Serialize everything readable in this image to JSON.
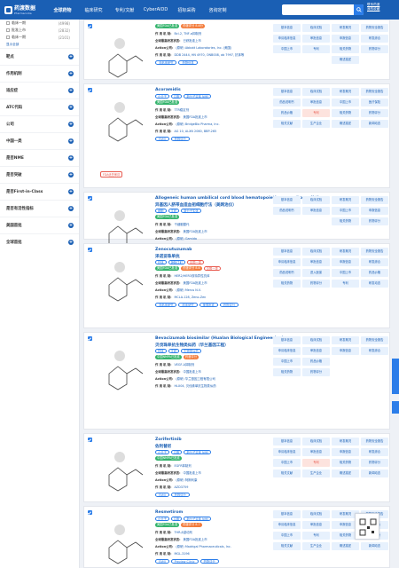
{
  "header": {
    "logo_text": "药渡数据",
    "logo_sub": "Pharmacodia",
    "nav": [
      "全球药物",
      "临床研究",
      "专利/文献",
      "CyberAIDD",
      "招标采购",
      "咨询定制"
    ],
    "search_placeholder": "",
    "links": [
      "联系药渡",
      "我的收藏"
    ]
  },
  "sidebar": {
    "options": [
      {
        "label": "临床一期",
        "count": "(4998)"
      },
      {
        "label": "批准上市",
        "count": "(2832)"
      },
      {
        "label": "临床一期",
        "count": "(2101)"
      }
    ],
    "more_link": "显示全部",
    "facets": [
      "靶点",
      "作用机制",
      "适应症",
      "ATC代码",
      "公司",
      "中国一类",
      "是否NME",
      "是否突破",
      "是否First-in-Class",
      "是否有活性指标",
      "美国首批",
      "全球首批"
    ]
  },
  "colors": {
    "header": "#1a5fb4",
    "accent": "#2b7de9",
    "tag_green": "#33b36b",
    "tag_orange": "#f37b3a",
    "highlight": "#e85a4f"
  },
  "cards": [
    {
      "title": "",
      "title2": "",
      "tags": [
        {
          "t": "美国FDA已批准",
          "c": "green"
        },
        {
          "t": "药渡评分 8.6分",
          "c": "orange"
        }
      ],
      "fields": [
        {
          "k": "作 用 机 制:",
          "v": "Bcl-2, TNF-α抑制剂"
        },
        {
          "k": "全球最高研发状态:",
          "v": "已获批准上市"
        },
        {
          "k": "Action公司:",
          "v": "(原研) Abbott Laboratories, Inc. (美国)"
        },
        {
          "k": "作 用 机 制:",
          "v": "DDB 2444, HN 4970, ONB008, ab 7997, 抗体等"
        }
      ],
      "btns": [
        "非临床研究",
        "药物信息"
      ],
      "grid": [
        "基本信息",
        "临床试验",
        "研发概况",
        "药物安全报告",
        "申请临床信息",
        "审批信息",
        "申报信息",
        "研发综合",
        "中国上市",
        "专利",
        "相关药物",
        "药物评分",
        "",
        "",
        "概述描述",
        ""
      ]
    },
    {
      "title": "Acoramidis",
      "title2": "",
      "tags": [
        {
          "t": "小分子",
          "c": "outline-blue"
        },
        {
          "t": "口服",
          "c": "outline-blue"
        },
        {
          "t": "新分子实体 NME",
          "c": "outline-blue"
        }
      ],
      "tags2": [
        {
          "t": "美国FDA已批准",
          "c": "green"
        }
      ],
      "fields": [
        {
          "k": "作 用 机 制:",
          "v": "TTR稳定剂"
        },
        {
          "k": "全球最高研发状态:",
          "v": "美国FDA批准上市"
        },
        {
          "k": "Action公司:",
          "v": "(原研) BridgeBio Pharma, Inc."
        },
        {
          "k": "作 用 机 制:",
          "v": "AG 10, ALXN 2060, BBP-265"
        }
      ],
      "btns": [
        "FAMI",
        "药物评分"
      ],
      "review": "FDA优先审评",
      "grid": [
        "基本信息",
        "临床试验",
        "研发概况",
        "药物安全报告",
        "药品说明书",
        "审批信息",
        "中国上市",
        "医疗保险",
        "药品价格",
        "专利",
        "相关药物",
        "药物评分",
        "相关文献",
        "生产企业",
        "概述描述",
        "新闻动态"
      ]
    },
    {
      "title": "Allogeneic human umbilical cord blood hematopoietic progenitor cell th...",
      "title2": "异基因人脐带血造血祖细胞疗法（美网治仪）",
      "tags": [
        {
          "t": "细胞",
          "c": "outline-blue"
        },
        {
          "t": "注射",
          "c": "outline-blue"
        },
        {
          "t": "新分子实体",
          "c": "outline-blue"
        }
      ],
      "tags2": [
        {
          "t": "美国FDA已批准",
          "c": "green"
        }
      ],
      "fields": [
        {
          "k": "作 用 机 制:",
          "v": "干细胞替代"
        },
        {
          "k": "全球最高研发状态:",
          "v": "美国FDA批准上市"
        },
        {
          "k": "Action公司:",
          "v": "(原研) Gamida"
        },
        {
          "k": "作 用 机 制:",
          "v": "NiCord, HPC, omidubicel"
        }
      ],
      "btns": [],
      "grid": [
        "基本信息",
        "临床试验",
        "研发概况",
        "药物安全报告",
        "药品说明书",
        "审批信息",
        "中国上市",
        "申报信息",
        "",
        "",
        "相关药物",
        "药物评分",
        "",
        "",
        "",
        ""
      ]
    },
    {
      "title": "Zenocutuzumab",
      "title2": "泽诺妥珠单抗",
      "tags": [
        {
          "t": "抗体",
          "c": "outline-blue"
        },
        {
          "t": "静脉注射",
          "c": "outline-blue"
        },
        {
          "t": "中国一类",
          "c": "outline-red"
        }
      ],
      "tags2": [
        {
          "t": "美国FDA已批准",
          "c": "green"
        },
        {
          "t": "药渡评分 8.6",
          "c": "orange"
        },
        {
          "t": "中国一类",
          "c": "outline-red"
        }
      ],
      "fields": [
        {
          "k": "作 用 机 制:",
          "v": "HER2/HER3双特异性抗体"
        },
        {
          "k": "全球最高研发状态:",
          "v": "美国FDA批准上市"
        },
        {
          "k": "Action公司:",
          "v": "(原研) Merus N.V."
        },
        {
          "k": "作 用 机 制:",
          "v": "MCLA-128, Zeno-Zen"
        }
      ],
      "btns": [
        "非临床研究",
        "临床研究",
        "美国批准",
        "药物评分"
      ],
      "grid": [
        "基本信息",
        "临床试验",
        "研发概况",
        "药物安全报告",
        "申请临床信息",
        "审批信息",
        "申报信息",
        "研发综合",
        "药品说明书",
        "进入医保",
        "中国上市",
        "药品价格",
        "相关药物",
        "药物评分",
        "专利",
        "研发动态"
      ]
    },
    {
      "title": "Bevacizumab biosimilar (Hualan Biological Engineering)",
      "title2": "贝伐珠单抗生物类似药（华兰基因工程）",
      "tags": [
        {
          "t": "抗体",
          "c": "outline-blue"
        },
        {
          "t": "注射",
          "c": "outline-blue"
        },
        {
          "t": "生物类似药",
          "c": "outline-blue"
        }
      ],
      "tags2": [
        {
          "t": "中国NMPA已批准",
          "c": "green"
        },
        {
          "t": "药渡评分",
          "c": "orange"
        }
      ],
      "fields": [
        {
          "k": "作 用 机 制:",
          "v": "VEGF-A抑制剂"
        },
        {
          "k": "全球最高研发状态:",
          "v": "中国批准上市"
        },
        {
          "k": "Action公司:",
          "v": "(原研) 华兰基因工程有限公司"
        },
        {
          "k": "作 用 机 制:",
          "v": "HLX04, 贝伐珠单抗生物类似药"
        }
      ],
      "btns": [],
      "grid": [
        "基本信息",
        "临床试验",
        "研发概况",
        "药物安全报告",
        "申请临床信息",
        "审批信息",
        "申报信息",
        "研发综合",
        "中国上市",
        "药品价格",
        "",
        "",
        "相关药物",
        "药物评分",
        "",
        ""
      ]
    },
    {
      "title": "Zorifertinib",
      "title2": "佐利替尼",
      "tags": [
        {
          "t": "小分子",
          "c": "outline-blue"
        },
        {
          "t": "口服",
          "c": "outline-blue"
        },
        {
          "t": "新分子实体 NME",
          "c": "outline-blue"
        }
      ],
      "tags2": [
        {
          "t": "中国NMPA已批准",
          "c": "green"
        }
      ],
      "fields": [
        {
          "k": "作 用 机 制:",
          "v": "EGFR抑制剂"
        },
        {
          "k": "全球最高研发状态:",
          "v": "中国批准上市"
        },
        {
          "k": "Action公司:",
          "v": "(原研) 阿斯利康"
        },
        {
          "k": "作 用 机 制:",
          "v": "AZD3759"
        }
      ],
      "btns": [
        "FAMI",
        "药物评分"
      ],
      "grid": [
        "基本信息",
        "临床试验",
        "研发概况",
        "药物安全报告",
        "申请临床信息",
        "审批信息",
        "申报信息",
        "研发综合",
        "中国上市",
        "专利",
        "相关药物",
        "药物评分",
        "相关文献",
        "生产企业",
        "概述描述",
        "新闻动态"
      ]
    },
    {
      "title": "Resmetirom",
      "title2": "",
      "tags": [
        {
          "t": "小分子",
          "c": "outline-blue"
        },
        {
          "t": "口服",
          "c": "outline-blue"
        },
        {
          "t": "新分子实体 NME",
          "c": "outline-blue"
        }
      ],
      "tags2": [
        {
          "t": "美国FDA已批准",
          "c": "green"
        },
        {
          "t": "药渡评分 8.7",
          "c": "orange"
        }
      ],
      "fields": [
        {
          "k": "作 用 机 制:",
          "v": "THR-β激动剂"
        },
        {
          "k": "全球最高研发状态:",
          "v": "美国FDA批准上市"
        },
        {
          "k": "Action公司:",
          "v": "(原研) Madrigal Pharmaceuticals, Inc."
        },
        {
          "k": "作 用 机 制:",
          "v": "MGL-3196"
        }
      ],
      "btns": [
        "FAMI",
        "Preview Clinic",
        "药物评分"
      ],
      "grid": [
        "基本信息",
        "临床试验",
        "研发概况",
        "药物安全报告",
        "申请临床信息",
        "审批信息",
        "申报信息",
        "研发综合",
        "中国上市",
        "专利",
        "相关药物",
        "药物评分",
        "相关文献",
        "生产企业",
        "概述描述",
        "新闻动态"
      ]
    }
  ]
}
